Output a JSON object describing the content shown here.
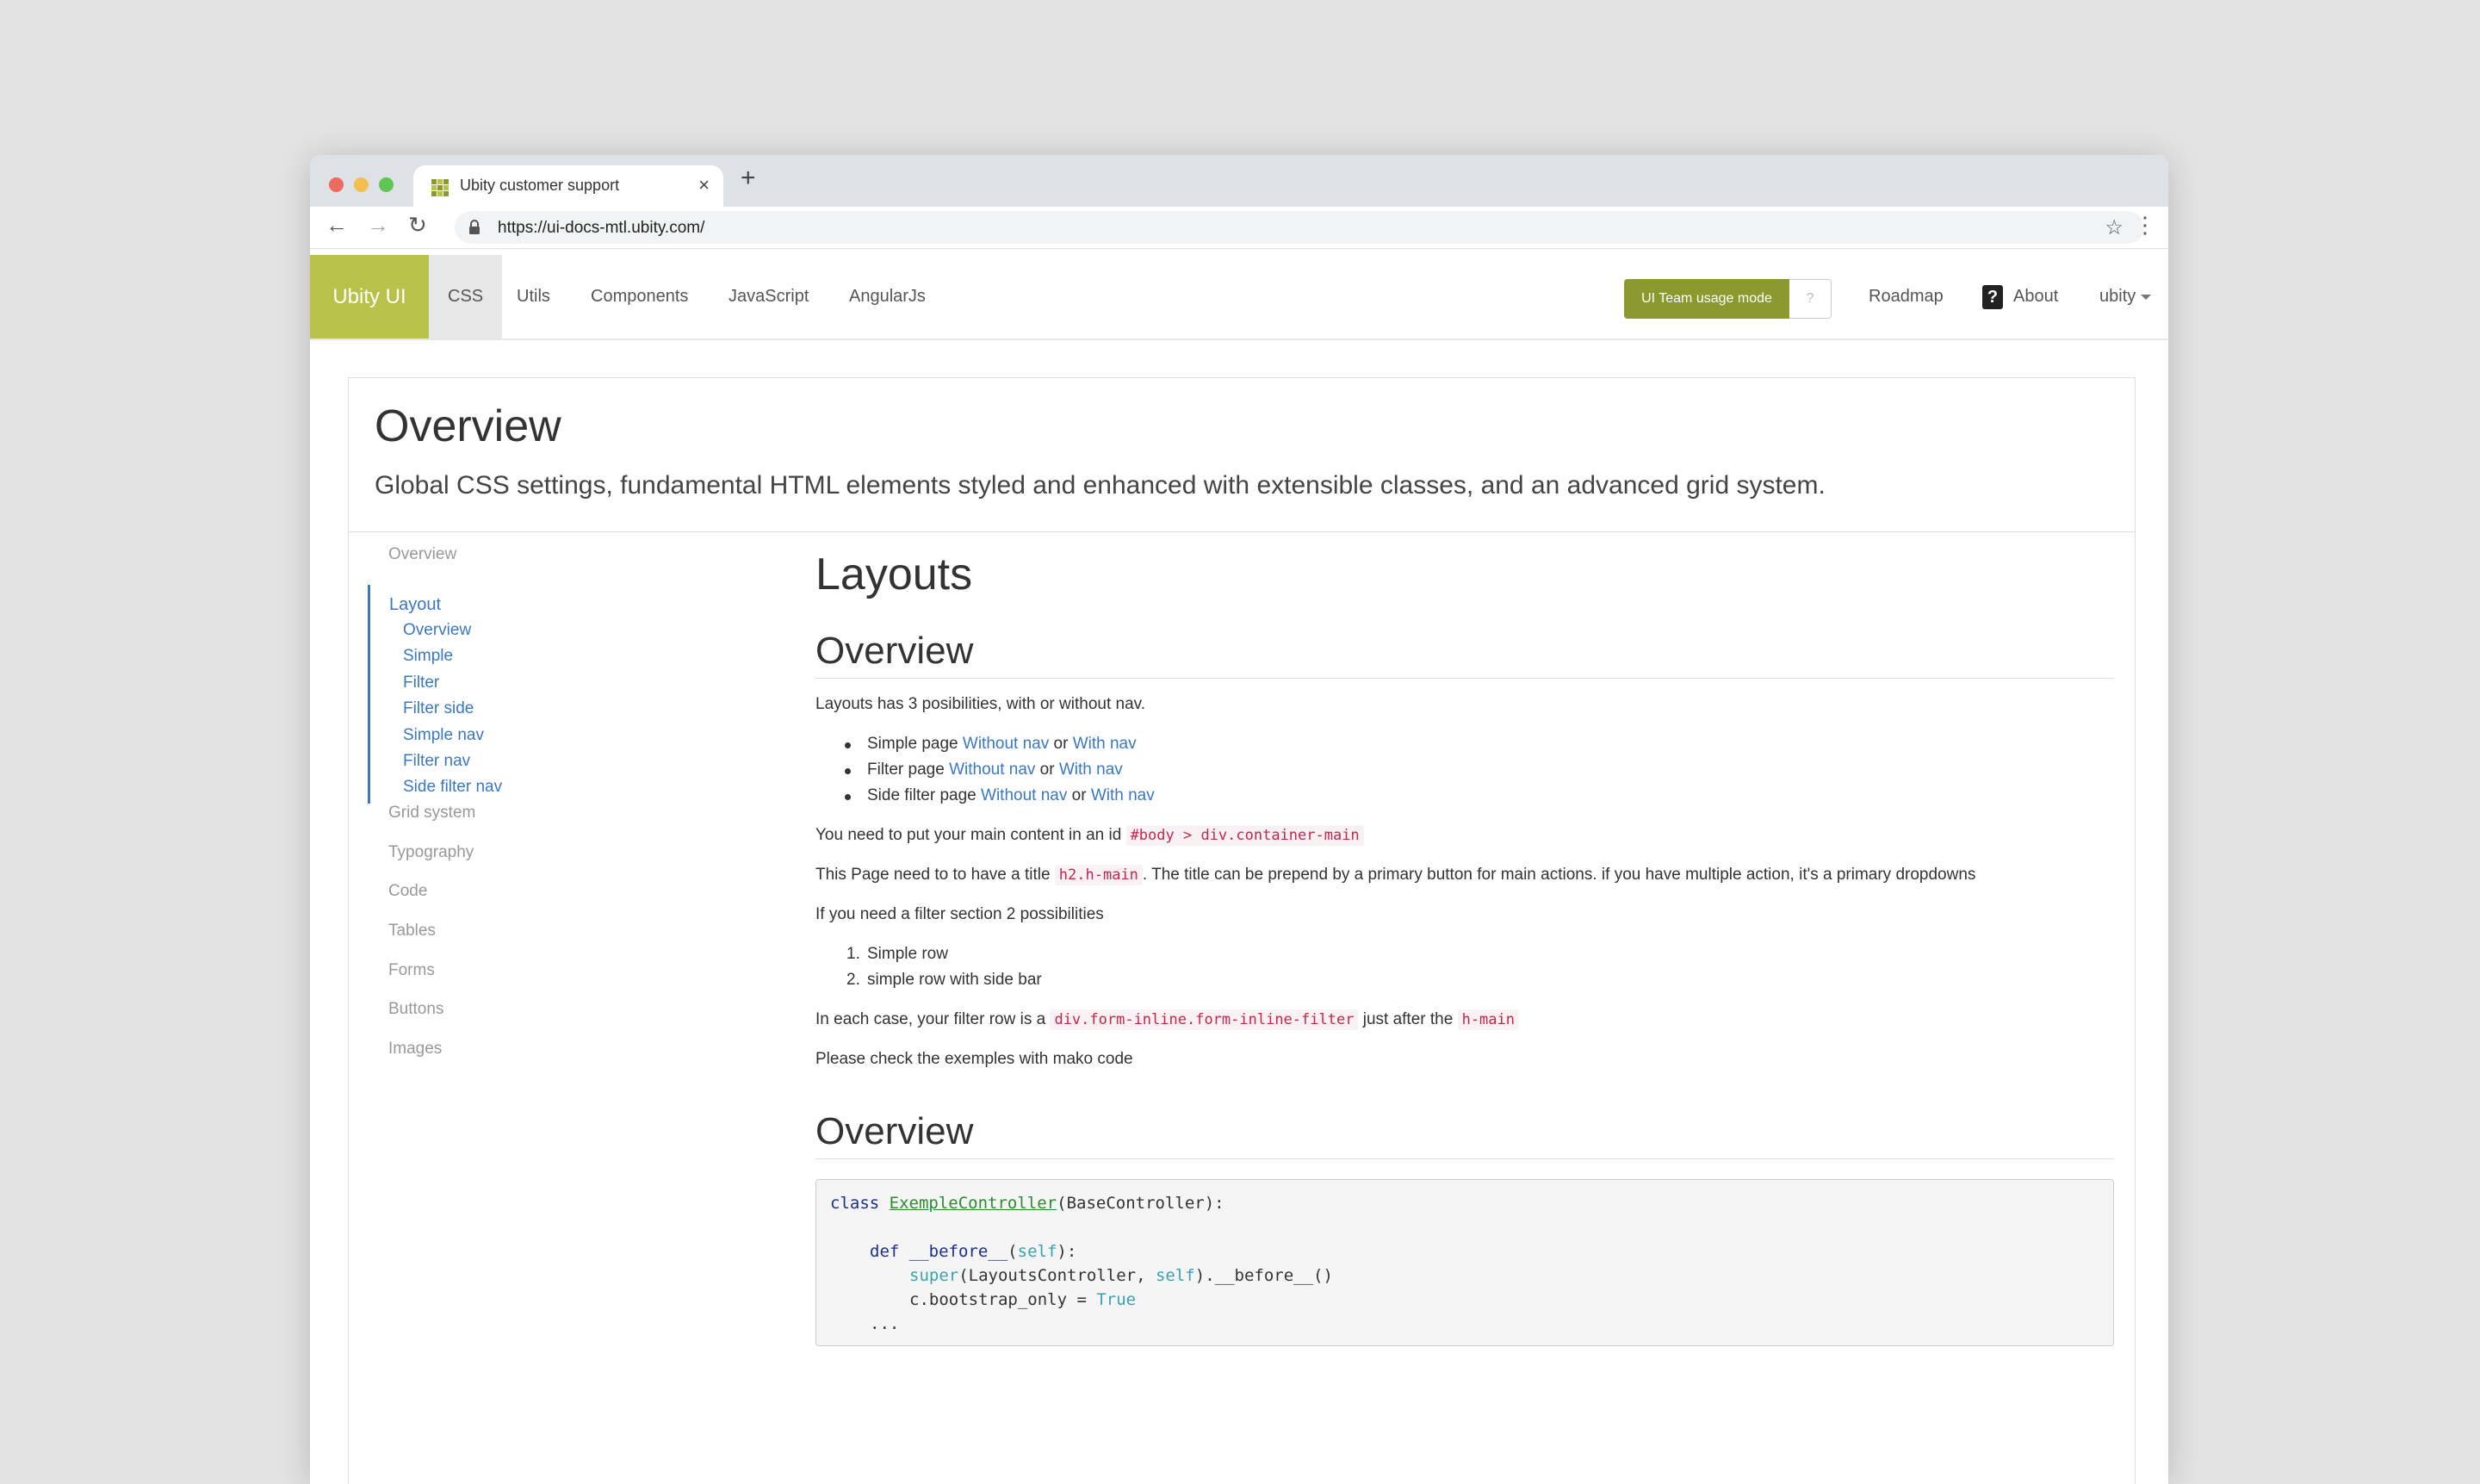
{
  "browser": {
    "tab_title": "Ubity customer support",
    "url": "https://ui-docs-mtl.ubity.com/",
    "new_tab_glyph": "+",
    "close_glyph": "×",
    "back_glyph": "←",
    "forward_glyph": "→",
    "reload_glyph": "↻",
    "star_glyph": "☆",
    "menu_glyph": "⋮",
    "traffic_lights": [
      "#ed6a5e",
      "#f5bf4f",
      "#61c554"
    ]
  },
  "navbar": {
    "brand": "Ubity UI",
    "brand_color": "#b8c24a",
    "items": [
      "CSS",
      "Utils",
      "Components",
      "JavaScript",
      "AngularJs"
    ],
    "mode_button": "UI Team usage mode",
    "help_glyph": "?",
    "roadmap": "Roadmap",
    "about_icon": "?",
    "about": "About",
    "user": "ubity"
  },
  "header": {
    "title": "Overview",
    "subtitle": "Global CSS settings, fundamental HTML elements styled and enhanced with extensible classes, and an advanced grid system."
  },
  "sidenav": {
    "top": "Overview",
    "layout_head": "Layout",
    "layout_items": [
      "Overview",
      "Simple",
      "Filter",
      "Filter side",
      "Simple nav",
      "Filter nav",
      "Side filter nav"
    ],
    "others": [
      "Grid system",
      "Typography",
      "Code",
      "Tables",
      "Forms",
      "Buttons",
      "Images"
    ]
  },
  "content": {
    "title": "Layouts",
    "section1": "Overview",
    "intro": "Layouts has 3 posibilities, with or without nav.",
    "bullets": [
      {
        "label": "Simple page",
        "a": "Without nav",
        "or": "or",
        "b": "With nav"
      },
      {
        "label": "Filter page",
        "a": "Without nav",
        "or": "or",
        "b": "With nav"
      },
      {
        "label": "Side filter page",
        "a": "Without nav",
        "or": "or",
        "b": "With nav"
      }
    ],
    "p1_text": "You need to put your main content in an id",
    "p1_code": "#body > div.container-main",
    "p2_text": "This Page need to to have a title",
    "p2_code": "h2.h-main",
    "p2_rest": ". The title can be prepend by a primary button for main actions. if you have multiple action, it's a primary dropdowns",
    "p3": "If you need a filter section 2 possibilities",
    "ordered": [
      "Simple row",
      "simple row with side bar"
    ],
    "p4_text": "In each case, your filter row is a",
    "p4_code": "div.form-inline.form-inline-filter",
    "p4_mid": "just after the",
    "p4_code2": "h-main",
    "p5": "Please check the exemples with mako code",
    "section2": "Overview",
    "code": {
      "l1_kw": "class",
      "l1_name": "ExempleController",
      "l1_rest": "(BaseController):",
      "l2_kw": "def",
      "l2_name": "__before__",
      "l2_self": "self",
      "l2_end": "):",
      "l3_super": "super",
      "l3_mid": "(LayoutsController, ",
      "l3_self": "self",
      "l3_end": ").__before__()",
      "l4_pre": "c.bootstrap_only = ",
      "l4_val": "True",
      "l5": "..."
    }
  }
}
